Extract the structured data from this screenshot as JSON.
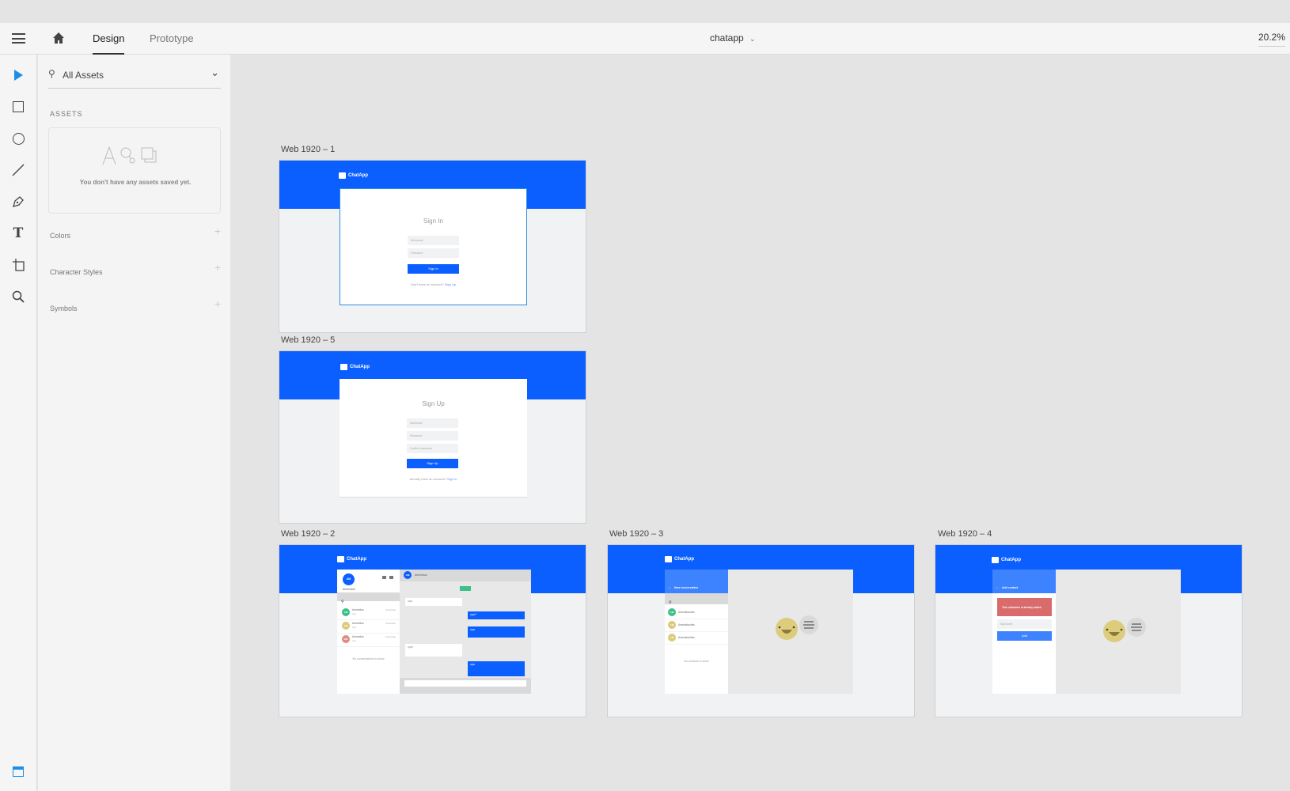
{
  "toolbar": {
    "tabs": [
      "Design",
      "Prototype"
    ],
    "doc_title": "chatapp",
    "zoom": "20.2%"
  },
  "panel": {
    "search": "All Assets",
    "assets_heading": "ASSETS",
    "empty_message": "You don't have any assets saved yet.",
    "sections": [
      "Colors",
      "Character Styles",
      "Symbols"
    ]
  },
  "colors": {
    "brand": "#0b5fff",
    "tool_active": "#1a8fe6",
    "error": "#d96b6b",
    "online": "#3dbf8a"
  },
  "artboards": {
    "f1": {
      "label": "Web 1920 – 1",
      "app": "ChatApp",
      "title": "Sign In",
      "fields": [
        "Nickname",
        "Password"
      ],
      "button": "Sign In",
      "footer": "Don't have an account?",
      "footer_link": "Sign Up"
    },
    "f5": {
      "label": "Web 1920 – 5",
      "app": "ChatApp",
      "title": "Sign Up",
      "fields": [
        "Nickname",
        "Password",
        "Confirm password"
      ],
      "button": "Sign Up",
      "footer": "Already have an account?",
      "footer_link": "Sign In"
    },
    "f2": {
      "label": "Web 1920 – 2",
      "app": "ChatApp",
      "me_initials": "AM",
      "me_name": "Amenidus",
      "contacts": [
        {
          "initials": "AM",
          "name": "Amenidus",
          "preview": "ops",
          "time": "Yesterday",
          "color": "#3dbf8a"
        },
        {
          "initials": "BM",
          "name": "Amenidus",
          "preview": "ops",
          "time": "Yesterday",
          "color": "#dcc97a"
        },
        {
          "initials": "BM",
          "name": "Amenidus",
          "preview": "ops",
          "time": "Yesterday",
          "color": "#e08a80"
        }
      ],
      "empty": "No conversations to show",
      "chat_name": "Amenidus",
      "messages": [
        {
          "text": "opa",
          "mine": false
        },
        {
          "text": "opa?",
          "mine": true
        },
        {
          "text": "opa",
          "mine": true
        },
        {
          "text": "opa!",
          "mine": false
        },
        {
          "text": "opa",
          "mine": true
        }
      ]
    },
    "f3": {
      "label": "Web 1920 – 3",
      "app": "ChatApp",
      "header": "New conversation",
      "contacts": [
        {
          "initials": "AM",
          "name": "Amenidus/dev",
          "color": "#3dbf8a"
        },
        {
          "initials": "AM",
          "name": "Amenidus/dev",
          "color": "#dcc97a"
        },
        {
          "initials": "AM",
          "name": "Amenidus/dev",
          "color": "#dcc97a"
        }
      ],
      "empty": "No contacts to show"
    },
    "f4": {
      "label": "Web 1920 – 4",
      "app": "ChatApp",
      "header": "Add contact",
      "error": "This nickname is already added",
      "field": "Nickname",
      "button": "Add"
    }
  }
}
